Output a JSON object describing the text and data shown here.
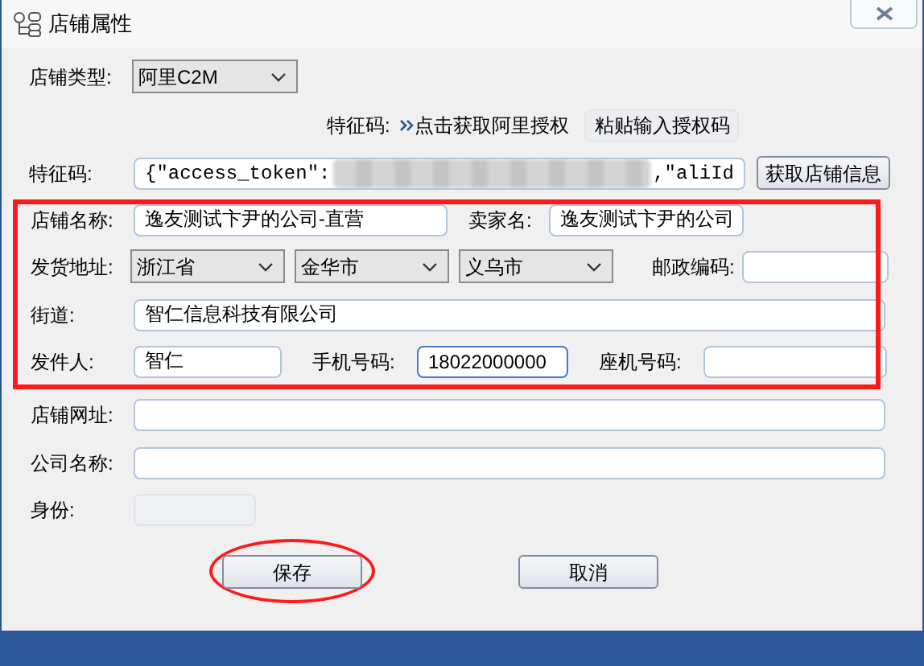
{
  "window": {
    "title": "店铺属性"
  },
  "shop_type": {
    "label": "店铺类型:",
    "value": "阿里C2M"
  },
  "auth": {
    "label": "特征码:",
    "link": "点击获取阿里授权",
    "button": "粘贴输入授权码"
  },
  "feature_code": {
    "label": "特征码:",
    "value_start": "{\"access_token\":",
    "value_end": ",\"aliId",
    "button": "获取店铺信息"
  },
  "highlighted_rows": [
    {
      "items": [
        {
          "kind": "label",
          "text": "店铺名称:"
        },
        {
          "kind": "text",
          "value": "逸友测试卞尹的公司-直营"
        },
        {
          "kind": "label",
          "text": "卖家名:"
        },
        {
          "kind": "text",
          "value": "逸友测试卞尹的公司"
        }
      ]
    },
    {
      "items": [
        {
          "kind": "label",
          "text": "发货地址:"
        },
        {
          "kind": "select",
          "value": "浙江省"
        },
        {
          "kind": "select",
          "value": "金华市"
        },
        {
          "kind": "select",
          "value": "义乌市"
        },
        {
          "kind": "label",
          "text": "邮政编码:"
        },
        {
          "kind": "text"
        }
      ]
    },
    {
      "items": [
        {
          "kind": "label",
          "text": "街道:"
        },
        {
          "kind": "text",
          "value": "智仁信息科技有限公司"
        }
      ]
    },
    {
      "items": [
        {
          "kind": "label",
          "text": "发件人:"
        },
        {
          "kind": "text",
          "value": "智仁"
        },
        {
          "kind": "label",
          "text": "手机号码:"
        },
        {
          "kind": "text",
          "value": "18022000000",
          "focused": true
        },
        {
          "kind": "label",
          "text": "座机号码:"
        },
        {
          "kind": "text"
        }
      ]
    }
  ],
  "rows": [
    {
      "items": [
        {
          "kind": "label",
          "text": "店铺网址:"
        },
        {
          "kind": "text"
        }
      ]
    },
    {
      "items": [
        {
          "kind": "label",
          "text": "公司名称:"
        },
        {
          "kind": "text"
        }
      ]
    },
    {
      "items": [
        {
          "kind": "label",
          "text": "身份:"
        },
        {
          "kind": "text",
          "disabled": true
        }
      ]
    }
  ],
  "buttons": [
    {
      "label": "保存",
      "highlighted": true
    },
    {
      "label": "取消",
      "highlighted": false
    }
  ]
}
